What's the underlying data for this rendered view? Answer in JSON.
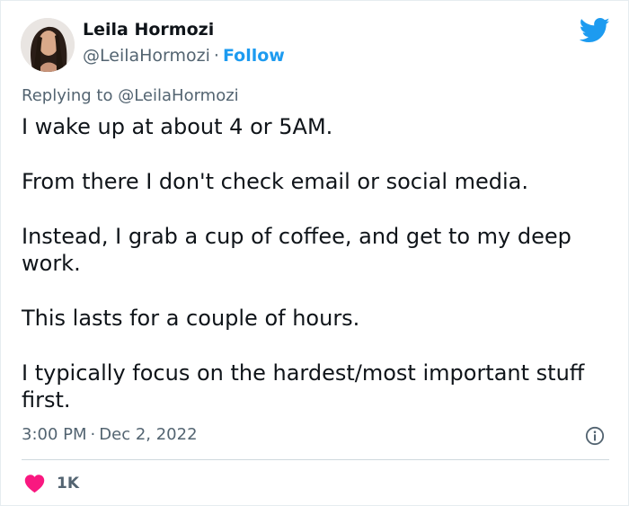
{
  "author": {
    "name": "Leila Hormozi",
    "handle": "@LeilaHormozi",
    "separator": "·",
    "follow_label": "Follow"
  },
  "reply": {
    "prefix": "Replying to",
    "mention": "@LeilaHormozi"
  },
  "tweet": {
    "paragraphs": [
      "I wake up at about 4 or 5AM.",
      "From there I don't check email or social media.",
      "Instead, I grab a cup of coffee, and get to my deep work.",
      "This lasts for a couple of hours.",
      "I typically focus on the hardest/most important stuff first."
    ]
  },
  "meta": {
    "time": "3:00 PM",
    "separator": "·",
    "date": "Dec 2, 2022"
  },
  "engagement": {
    "likes": "1K"
  },
  "icons": {
    "brand": "twitter-bird-icon",
    "info": "info-icon",
    "like": "heart-icon"
  },
  "colors": {
    "brand_blue": "#1d9bf0",
    "heart_red": "#f91880",
    "secondary_text": "#536471",
    "primary_text": "#0f1419"
  }
}
